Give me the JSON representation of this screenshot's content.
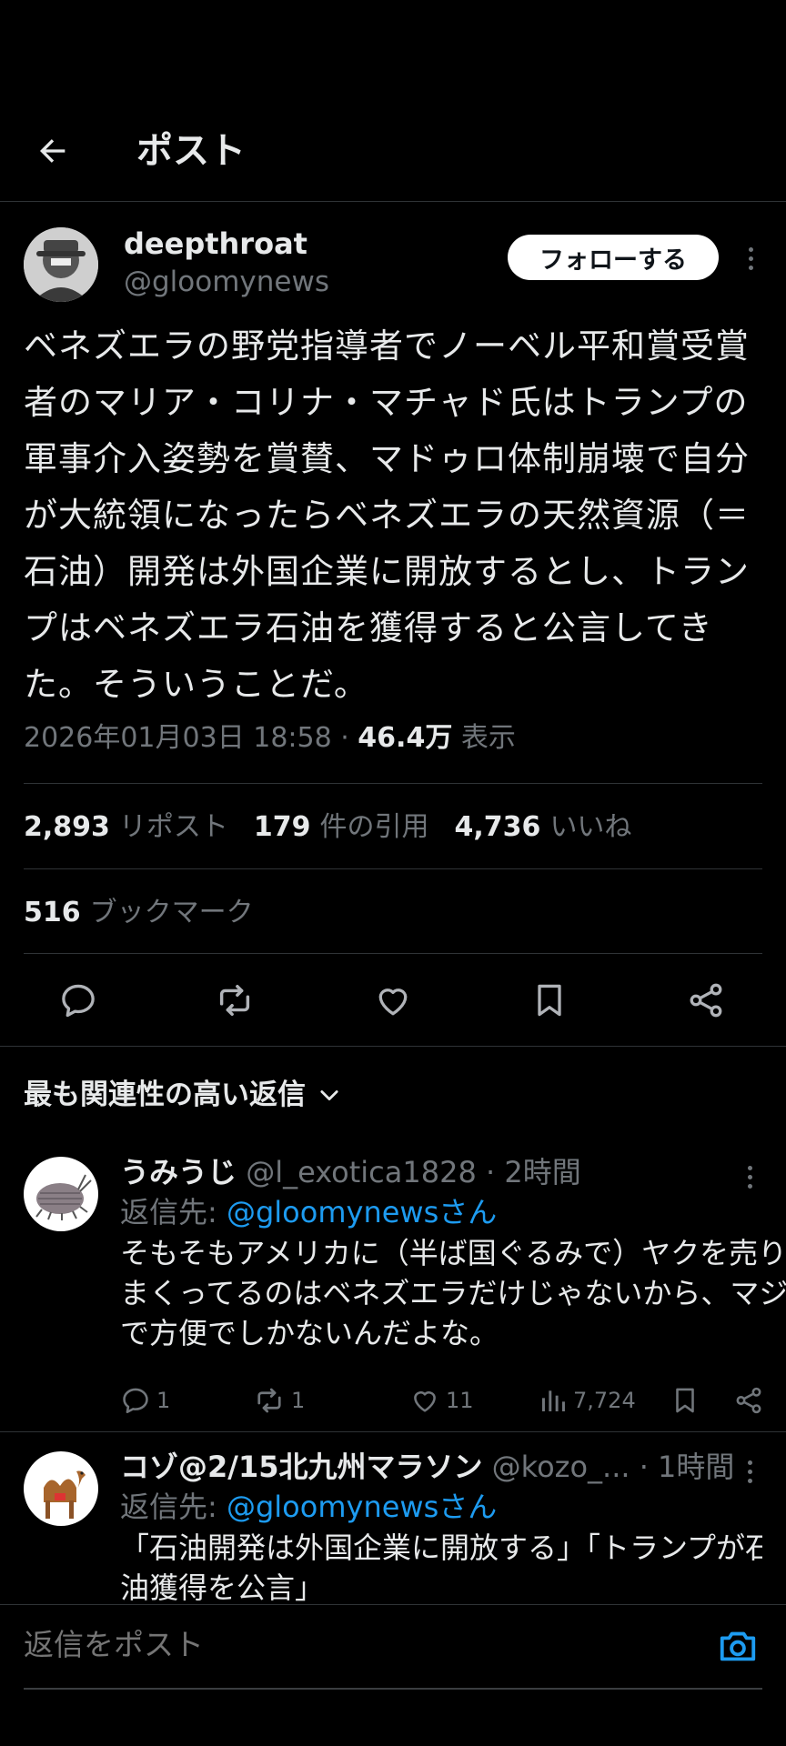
{
  "header": {
    "title": "ポスト"
  },
  "post": {
    "author_name": "deepthroat",
    "author_handle": "@gloomynews",
    "follow_label": "フォローする",
    "text": "ベネズエラの野党指導者でノーベル平和賞受賞者のマリア・コリナ・マチャド氏はトランプの軍事介入姿勢を賞賛、マドゥロ体制崩壊で自分が大統領になったらベネズエラの天然資源（＝石油）開発は外国企業に開放するとし、トランプはベネズエラ石油を獲得すると公言してきた。そういうことだ。",
    "timestamp": "2026年01月03日 18:58",
    "separator": " · ",
    "views": "46.4万",
    "views_label": " 表示",
    "reposts": "2,893",
    "reposts_label": "リポスト",
    "quotes": "179",
    "quotes_label": "件の引用",
    "likes": "4,736",
    "likes_label": "いいね",
    "bookmarks": "516",
    "bookmarks_label": "ブックマーク"
  },
  "sort": {
    "label": "最も関連性の高い返信"
  },
  "replies": [
    {
      "name": "うみうじ",
      "handle": "@l_exotica1828",
      "time": " · 2時間",
      "reply_to_prefix": "返信先: ",
      "reply_to": "@gloomynewsさん",
      "text": "そもそもアメリカに（半ば国ぐるみで）ヤクを売りまくってるのはベネズエラだけじゃないから、マジで方便でしかないんだよな。",
      "replies": "1",
      "reposts": "1",
      "likes": "11",
      "views": "7,724"
    },
    {
      "name": "コゾ@2/15北九州マラソン",
      "handle": "@kozo_...",
      "time": " · 1時間",
      "reply_to_prefix": "返信先: ",
      "reply_to": "@gloomynewsさん",
      "text": "「石油開発は外国企業に開放する」「トランプが石油獲得を公言」"
    }
  ],
  "composer": {
    "placeholder": "返信をポスト"
  },
  "colors": {
    "accent": "#1d9bf0",
    "background": "#000000",
    "muted": "#71767b"
  }
}
